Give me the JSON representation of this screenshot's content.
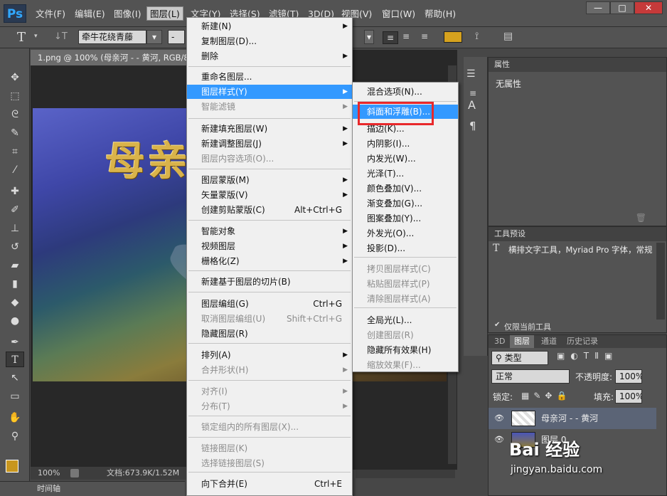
{
  "app": {
    "logo": "Ps"
  },
  "menubar": [
    {
      "label": "文件(F)"
    },
    {
      "label": "编辑(E)"
    },
    {
      "label": "图像(I)"
    },
    {
      "label": "图层(L)"
    },
    {
      "label": "文字(Y)"
    },
    {
      "label": "选择(S)"
    },
    {
      "label": "滤镜(T)"
    },
    {
      "label": "3D(D)"
    },
    {
      "label": "视图(V)"
    },
    {
      "label": "窗口(W)"
    },
    {
      "label": "帮助(H)"
    }
  ],
  "window_controls": {
    "minimize": "—",
    "restore": "□",
    "close": "✕"
  },
  "options": {
    "font_family": "牵牛花绕青藤",
    "font_style": "-",
    "color": "#d6a21e"
  },
  "document": {
    "tab_title": "1.png @ 100% (母亲河 - - 黄河, RGB/8)",
    "zoom": "100%",
    "doc_size": "文档:673.9K/1.52M",
    "canvas_text": "母亲"
  },
  "layer_menu": [
    {
      "label": "新建(N)",
      "arrow": "▶"
    },
    {
      "label": "复制图层(D)..."
    },
    {
      "label": "删除",
      "arrow": "▶"
    },
    {
      "label": "重命名图层..."
    },
    {
      "label": "图层样式(Y)",
      "arrow": "▶"
    },
    {
      "label": "智能滤镜",
      "arrow": "▶"
    },
    {
      "label": "新建填充图层(W)",
      "arrow": "▶"
    },
    {
      "label": "新建调整图层(J)",
      "arrow": "▶"
    },
    {
      "label": "图层内容选项(O)..."
    },
    {
      "label": "图层蒙版(M)",
      "arrow": "▶"
    },
    {
      "label": "矢量蒙版(V)",
      "arrow": "▶"
    },
    {
      "label": "创建剪贴蒙版(C)",
      "shortcut": "Alt+Ctrl+G"
    },
    {
      "label": "智能对象",
      "arrow": "▶"
    },
    {
      "label": "视频图层",
      "arrow": "▶"
    },
    {
      "label": "栅格化(Z)",
      "arrow": "▶"
    },
    {
      "label": "新建基于图层的切片(B)"
    },
    {
      "label": "图层编组(G)",
      "shortcut": "Ctrl+G"
    },
    {
      "label": "取消图层编组(U)",
      "shortcut": "Shift+Ctrl+G"
    },
    {
      "label": "隐藏图层(R)"
    },
    {
      "label": "排列(A)",
      "arrow": "▶"
    },
    {
      "label": "合并形状(H)",
      "arrow": "▶"
    },
    {
      "label": "对齐(I)",
      "arrow": "▶"
    },
    {
      "label": "分布(T)",
      "arrow": "▶"
    },
    {
      "label": "锁定组内的所有图层(X)..."
    },
    {
      "label": "链接图层(K)"
    },
    {
      "label": "选择链接图层(S)"
    },
    {
      "label": "向下合并(E)",
      "shortcut": "Ctrl+E"
    }
  ],
  "style_menu": [
    {
      "label": "混合选项(N)..."
    },
    {
      "label": "斜面和浮雕(B)..."
    },
    {
      "label": "描边(K)..."
    },
    {
      "label": "内阴影(I)..."
    },
    {
      "label": "内发光(W)..."
    },
    {
      "label": "光泽(T)..."
    },
    {
      "label": "颜色叠加(V)..."
    },
    {
      "label": "渐变叠加(G)..."
    },
    {
      "label": "图案叠加(Y)..."
    },
    {
      "label": "外发光(O)..."
    },
    {
      "label": "投影(D)..."
    },
    {
      "label": "拷贝图层样式(C)"
    },
    {
      "label": "粘贴图层样式(P)"
    },
    {
      "label": "清除图层样式(A)"
    },
    {
      "label": "全局光(L)..."
    },
    {
      "label": "创建图层(R)"
    },
    {
      "label": "隐藏所有效果(H)"
    },
    {
      "label": "缩放效果(F)..."
    }
  ],
  "properties": {
    "title": "属性",
    "empty": "无属性"
  },
  "tool_presets": {
    "title": "工具预设",
    "item": "横排文字工具，Myriad Pro 字体，常规",
    "current_only": "仅限当前工具"
  },
  "layers_panel": {
    "tabs": [
      "3D",
      "图层",
      "通道",
      "历史记录"
    ],
    "filter": "类型",
    "blend_mode": "正常",
    "opacity_label": "不透明度:",
    "opacity": "100%",
    "lock_label": "锁定:",
    "fill_label": "填充:",
    "fill": "100%",
    "layers": [
      {
        "name": "母亲河 - - 黄河"
      },
      {
        "name": "图层 0"
      }
    ]
  },
  "timeline": {
    "label": "时间轴"
  },
  "watermark": {
    "logo": "Bai 经验",
    "url": "jingyan.baidu.com"
  }
}
